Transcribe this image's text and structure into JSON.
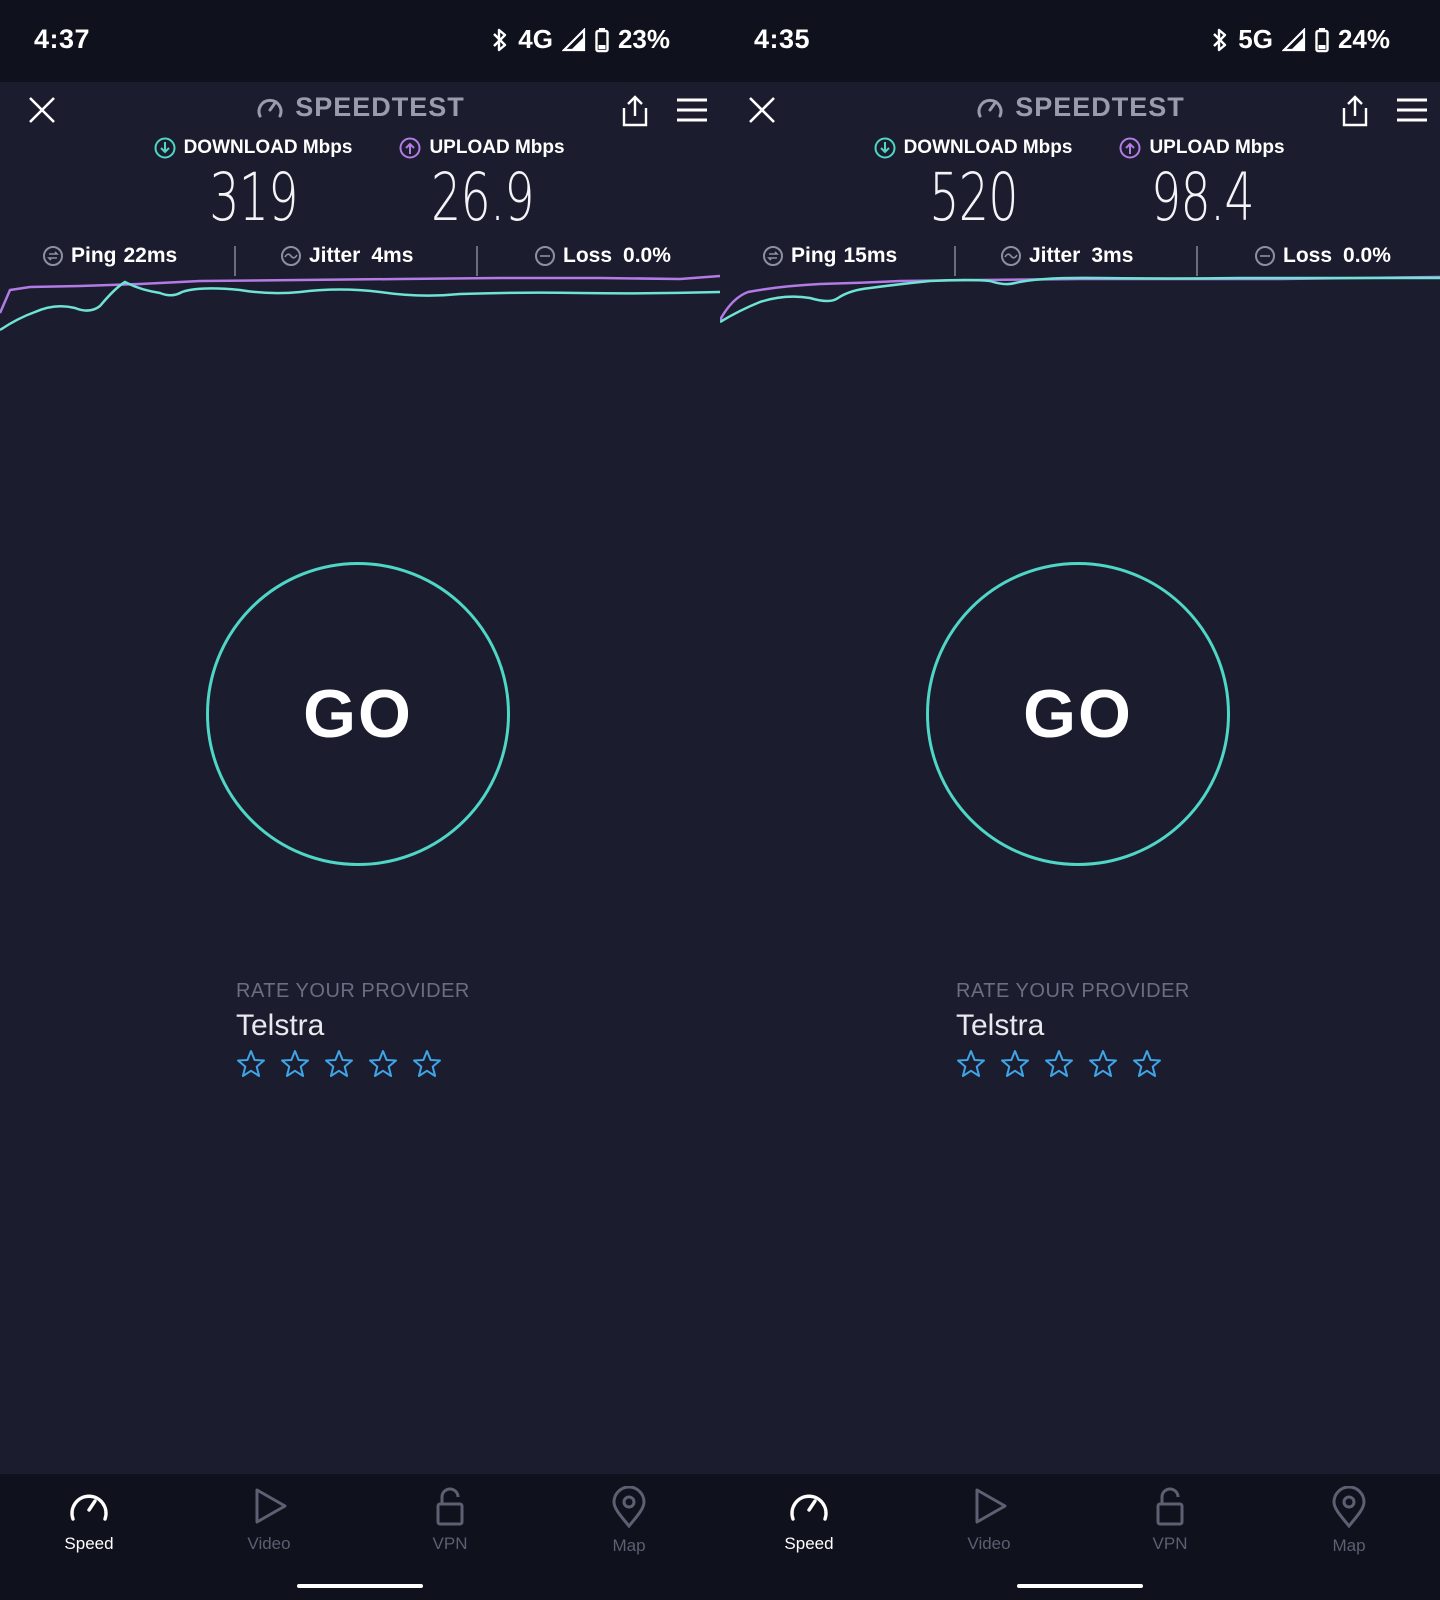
{
  "phones": [
    {
      "status": {
        "time": "4:37",
        "network": "4G",
        "battery": "23%"
      },
      "header": {
        "title": "SPEEDTEST"
      },
      "metrics": {
        "download_label": "DOWNLOAD Mbps",
        "download_value": "319",
        "upload_label": "UPLOAD Mbps",
        "upload_value": "26.9"
      },
      "stats": {
        "ping_label": "Ping",
        "ping_value": "22ms",
        "jitter_label": "Jitter",
        "jitter_value": "4ms",
        "loss_label": "Loss",
        "loss_value": "0.0%"
      },
      "go_label": "GO",
      "rate": {
        "heading": "RATE YOUR PROVIDER",
        "provider": "Telstra"
      },
      "nav": [
        {
          "label": "Speed",
          "icon": "speedometer-icon"
        },
        {
          "label": "Video",
          "icon": "play-icon"
        },
        {
          "label": "VPN",
          "icon": "lock-icon"
        },
        {
          "label": "Map",
          "icon": "map-pin-icon"
        }
      ]
    },
    {
      "status": {
        "time": "4:35",
        "network": "5G",
        "battery": "24%"
      },
      "header": {
        "title": "SPEEDTEST"
      },
      "metrics": {
        "download_label": "DOWNLOAD Mbps",
        "download_value": "520",
        "upload_label": "UPLOAD Mbps",
        "upload_value": "98.4"
      },
      "stats": {
        "ping_label": "Ping",
        "ping_value": "15ms",
        "jitter_label": "Jitter",
        "jitter_value": "3ms",
        "loss_label": "Loss",
        "loss_value": "0.0%"
      },
      "go_label": "GO",
      "rate": {
        "heading": "RATE YOUR PROVIDER",
        "provider": "Telstra"
      },
      "nav": [
        {
          "label": "Speed",
          "icon": "speedometer-icon"
        },
        {
          "label": "Video",
          "icon": "play-icon"
        },
        {
          "label": "VPN",
          "icon": "lock-icon"
        },
        {
          "label": "Map",
          "icon": "map-pin-icon"
        }
      ]
    }
  ],
  "colors": {
    "background": "#1b1d2e",
    "bar": "#0f111d",
    "download_accent": "#4fd6c6",
    "upload_accent": "#b27be6",
    "star": "#3fa4e8"
  }
}
